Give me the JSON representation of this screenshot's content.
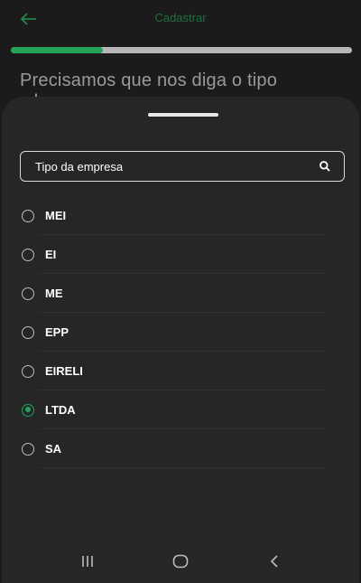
{
  "header": {
    "title": "Cadastrar",
    "back_icon": "arrow-left-icon"
  },
  "progress": {
    "value": 0.27
  },
  "question": {
    "line1": "Precisamos que nos diga o tipo",
    "line2": "d"
  },
  "search": {
    "placeholder": "Tipo da empresa"
  },
  "options": [
    {
      "label": "MEI",
      "checked": false
    },
    {
      "label": "EI",
      "checked": false
    },
    {
      "label": "ME",
      "checked": false
    },
    {
      "label": "EPP",
      "checked": false
    },
    {
      "label": "EIRELI",
      "checked": false
    },
    {
      "label": "LTDA",
      "checked": true
    },
    {
      "label": "SA",
      "checked": false
    }
  ],
  "colors": {
    "accent": "#22a45d",
    "background": "#1b1b1b",
    "sheet": "#262626"
  },
  "navbar": {
    "icons": [
      "recent-apps-icon",
      "home-icon",
      "back-icon"
    ]
  }
}
